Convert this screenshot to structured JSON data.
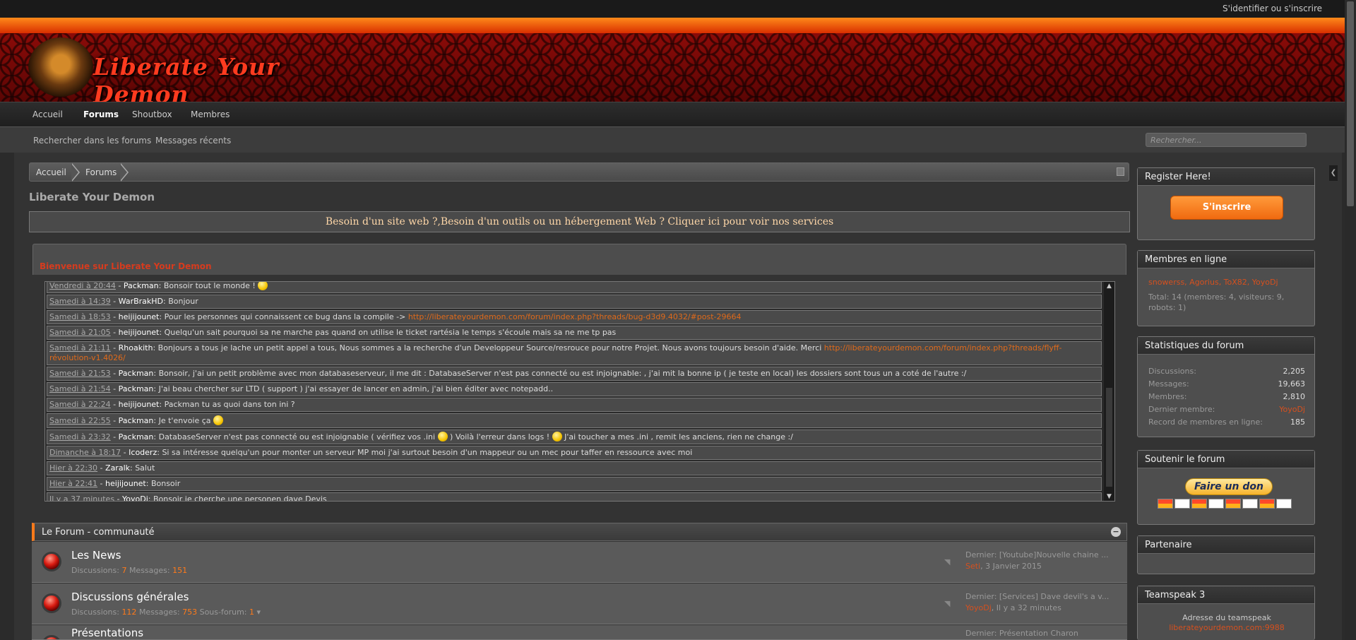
{
  "topbar": {
    "login": "S'identifier ou s'inscrire"
  },
  "header": {
    "logo_text": "Liberate Your Demon"
  },
  "nav": {
    "tabs": [
      "Accueil",
      "Forums",
      "Shoutbox",
      "Membres"
    ],
    "active": "Forums"
  },
  "subnav": {
    "links": [
      "Rechercher dans les forums",
      "Messages récents"
    ],
    "search_placeholder": "Rechercher..."
  },
  "breadcrumb": [
    "Accueil",
    "Forums"
  ],
  "page_title": "Liberate Your Demon",
  "notice": "Besoin d'un site web ?,Besoin d'un outils ou un hébergement Web ? Cliquer ici pour voir nos services",
  "shoutbox": {
    "title": "Bienvenue sur Liberate Your Demon",
    "messages": [
      {
        "time": "Vendredi à 20:44",
        "user": "Packman",
        "text": "Bonsoir  tout le monde !",
        "smile": true
      },
      {
        "time": "Samedi à 14:39",
        "user": "WarBrakHD",
        "text": "Bonjour"
      },
      {
        "time": "Samedi à 18:53",
        "user": "heijijounet",
        "text": "Pour les personnes qui connaissent ce bug dans la compile ->",
        "link": "http://liberateyourdemon.com/forum/index.php?threads/bug-d3d9.4032/#post-29664"
      },
      {
        "time": "Samedi à 21:05",
        "user": "heijijounet",
        "text": "Quelqu'un sait pourquoi sa ne marche pas quand on utilise le ticket rartésia le temps s'écoule mais sa ne me tp pas"
      },
      {
        "time": "Samedi à 21:11",
        "user": "Rhoakith",
        "text": "Bonjours a tous je lache un petit appel a tous, Nous sommes a la recherche d'un Developpeur Source/resrouce pour notre Projet. Nous avons toujours besoin d'aide. Merci",
        "link": "http://liberateyourdemon.com/forum/index.php?threads/flyff-révolution-v1.4026/"
      },
      {
        "time": "Samedi à 21:53",
        "user": "Packman",
        "text": "Bonsoir, j'ai un petit problème avec mon databaseserveur, il me dit : DatabaseServer n'est pas connecté ou est injoignable: , j'ai mit la bonne ip ( je teste en local) les dossiers sont tous un a coté de l'autre :/"
      },
      {
        "time": "Samedi à 21:54",
        "user": "Packman",
        "text": "J'ai beau chercher sur LTD ( support ) j'ai essayer de lancer en admin, j'ai bien éditer avec notepadd.."
      },
      {
        "time": "Samedi à 22:24",
        "user": "heijijounet",
        "text": "Packman tu as quoi dans ton ini ?"
      },
      {
        "time": "Samedi à 22:55",
        "user": "Packman",
        "text": "Je t'envoie ça",
        "smile": true
      },
      {
        "time": "Samedi à 23:32",
        "user": "Packman",
        "text": "DatabaseServer n'est pas connecté ou est injoignable ( vérifiez vos .ini ",
        "text2": " ) Voilà l'erreur dans logs ! ",
        "text3": " J'ai toucher a mes .ini , remit les anciens, rien ne change :/",
        "smile": true
      },
      {
        "time": "Dimanche à 18:17",
        "user": "Icoderz",
        "text": "Si sa intéresse quelqu'un pour monter un serveur MP moi j'ai surtout besoin d'un mappeur ou un mec pour taffer en ressource avec moi"
      },
      {
        "time": "Hier à 22:30",
        "user": "Zaralk",
        "text": "Salut"
      },
      {
        "time": "Hier à 22:41",
        "user": "heijijounet",
        "text": "Bonsoir"
      },
      {
        "time": "Il y a 37 minutes",
        "user": "YoyoDj",
        "text": "Bonsoir je cherche une personen dave Devis"
      }
    ]
  },
  "category": {
    "title": "Le Forum - communauté"
  },
  "forums": [
    {
      "name": "Les News",
      "discussions_label": "Discussions:",
      "discussions": "7",
      "messages_label": "Messages:",
      "messages": "151",
      "subforum_label": "",
      "subforum": "",
      "last": "Dernier: [Youtube]Nouvelle chaine ...",
      "last_user": "Seti",
      "last_date": "3 Janvier 2015"
    },
    {
      "name": "Discussions générales",
      "discussions_label": "Discussions:",
      "discussions": "112",
      "messages_label": "Messages:",
      "messages": "753",
      "subforum_label": "Sous-forum:",
      "subforum": "1",
      "last": "Dernier: [Services] Dave devil's a v...",
      "last_user": "YoyoDj",
      "last_date": "Il y a 32 minutes"
    },
    {
      "name": "Présentations",
      "discussions_label": "",
      "discussions": "",
      "messages_label": "",
      "messages": "",
      "subforum_label": "",
      "subforum": "",
      "last": "Dernier: Présentation Charon",
      "last_user": "",
      "last_date": ""
    }
  ],
  "sidebar": {
    "register": {
      "title": "Register Here!",
      "button": "S'inscrire"
    },
    "online": {
      "title": "Membres en ligne",
      "names": "snowerss, Agorius, ToX82, YoyoDj",
      "total": "Total: 14 (membres: 4, visiteurs: 9, robots: 1)"
    },
    "stats": {
      "title": "Statistiques du forum",
      "rows": [
        {
          "label": "Discussions:",
          "value": "2,205"
        },
        {
          "label": "Messages:",
          "value": "19,663"
        },
        {
          "label": "Membres:",
          "value": "2,810"
        },
        {
          "label": "Dernier membre:",
          "value": "YoyoDj"
        },
        {
          "label": "Record de membres en ligne:",
          "value": "185"
        }
      ]
    },
    "donate": {
      "title": "Soutenir le forum",
      "button": "Faire un don"
    },
    "partner": {
      "title": "Partenaire"
    },
    "teamspeak": {
      "title": "Teamspeak 3",
      "label": "Adresse du teamspeak",
      "address": "liberateyourdemon.com:9988"
    }
  },
  "colors": {
    "accent": "#ff7a1a",
    "header_red": "#8c0b08",
    "link": "#d6501e"
  }
}
